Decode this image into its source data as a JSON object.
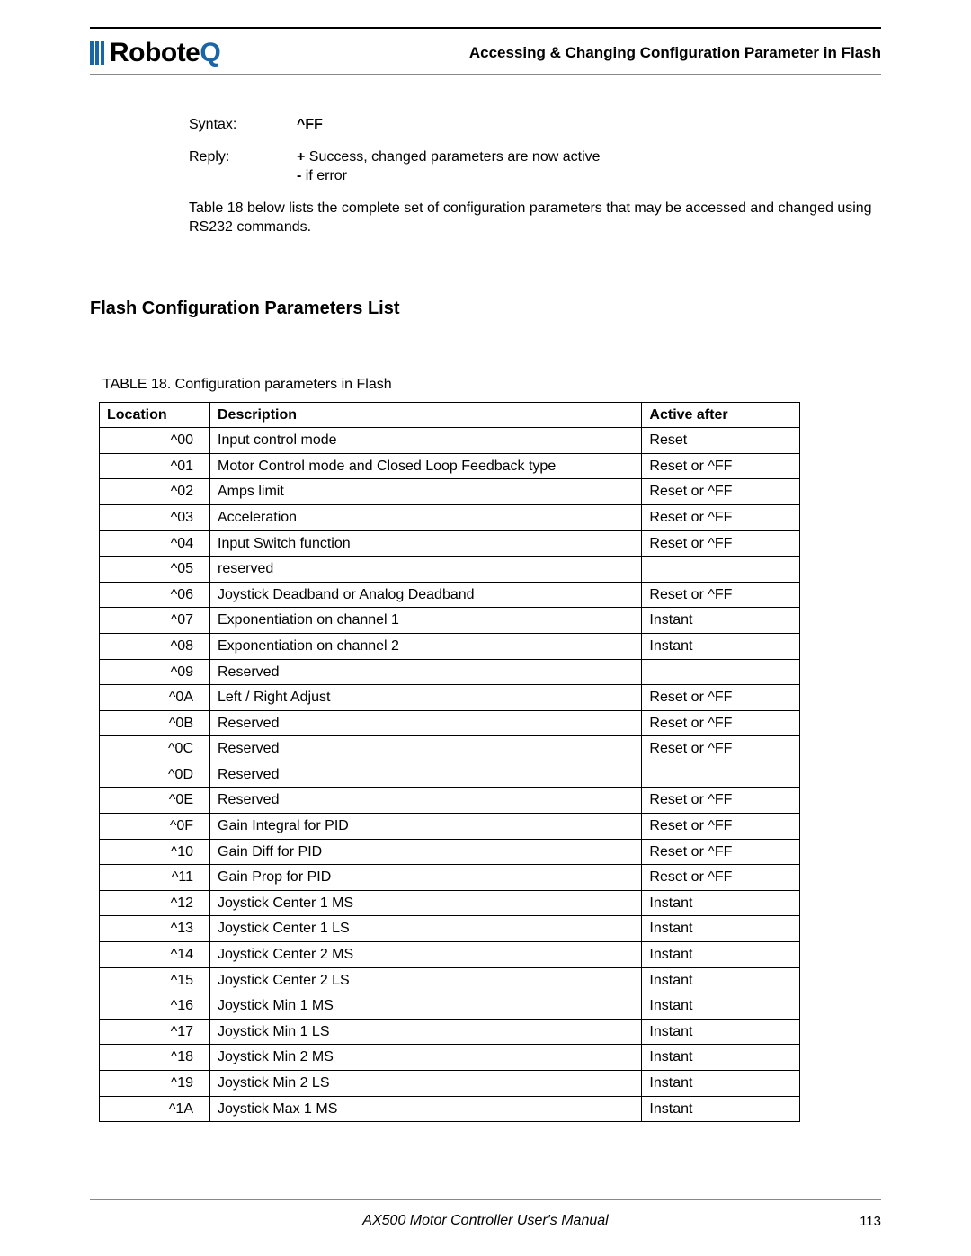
{
  "header": {
    "brand_text": "Robote",
    "brand_q": "Q",
    "title": "Accessing & Changing Configuration Parameter in Flash"
  },
  "syntax": {
    "label": "Syntax:",
    "value": "^FF"
  },
  "reply": {
    "label": "Reply:",
    "line1_prefix": "+",
    "line1_rest": " Success, changed parameters are now active",
    "line2_prefix": "-",
    "line2_rest": " if error"
  },
  "intro_para": "Table 18 below lists the complete set of configuration parameters that may be accessed and changed using RS232 commands.",
  "section_heading": "Flash Configuration Parameters List",
  "table_caption": "TABLE 18. Configuration parameters in Flash",
  "table_headers": {
    "location": "Location",
    "description": "Description",
    "active_after": "Active after"
  },
  "rows": [
    {
      "loc": "^00",
      "desc": "Input control mode",
      "act": "Reset"
    },
    {
      "loc": "^01",
      "desc": "Motor Control mode and Closed Loop Feedback type",
      "act": "Reset or ^FF"
    },
    {
      "loc": "^02",
      "desc": "Amps limit",
      "act": "Reset or ^FF"
    },
    {
      "loc": "^03",
      "desc": "Acceleration",
      "act": "Reset or ^FF"
    },
    {
      "loc": "^04",
      "desc": "Input Switch function",
      "act": "Reset or ^FF"
    },
    {
      "loc": "^05",
      "desc": "reserved",
      "act": ""
    },
    {
      "loc": "^06",
      "desc": "Joystick Deadband or Analog Deadband",
      "act": "Reset or ^FF"
    },
    {
      "loc": "^07",
      "desc": "Exponentiation on channel 1",
      "act": "Instant"
    },
    {
      "loc": "^08",
      "desc": "Exponentiation on channel 2",
      "act": "Instant"
    },
    {
      "loc": "^09",
      "desc": "Reserved",
      "act": ""
    },
    {
      "loc": "^0A",
      "desc": "Left / Right Adjust",
      "act": "Reset or ^FF"
    },
    {
      "loc": "^0B",
      "desc": "Reserved",
      "act": "Reset or ^FF"
    },
    {
      "loc": "^0C",
      "desc": "Reserved",
      "act": "Reset or ^FF"
    },
    {
      "loc": "^0D",
      "desc": "Reserved",
      "act": ""
    },
    {
      "loc": "^0E",
      "desc": "Reserved",
      "act": "Reset or ^FF"
    },
    {
      "loc": "^0F",
      "desc": "Gain Integral for PID",
      "act": "Reset or ^FF"
    },
    {
      "loc": "^10",
      "desc": "Gain Diff for PID",
      "act": "Reset or ^FF"
    },
    {
      "loc": "^11",
      "desc": "Gain Prop for PID",
      "act": "Reset or ^FF"
    },
    {
      "loc": "^12",
      "desc": "Joystick Center 1 MS",
      "act": "Instant"
    },
    {
      "loc": "^13",
      "desc": "Joystick Center 1 LS",
      "act": "Instant"
    },
    {
      "loc": "^14",
      "desc": "Joystick Center 2 MS",
      "act": "Instant"
    },
    {
      "loc": "^15",
      "desc": "Joystick Center 2 LS",
      "act": "Instant"
    },
    {
      "loc": "^16",
      "desc": "Joystick Min 1 MS",
      "act": "Instant"
    },
    {
      "loc": "^17",
      "desc": "Joystick Min 1 LS",
      "act": "Instant"
    },
    {
      "loc": "^18",
      "desc": "Joystick Min 2 MS",
      "act": "Instant"
    },
    {
      "loc": "^19",
      "desc": "Joystick Min 2 LS",
      "act": "Instant"
    },
    {
      "loc": "^1A",
      "desc": "Joystick Max 1 MS",
      "act": "Instant"
    }
  ],
  "footer": {
    "title": "AX500 Motor Controller User's Manual",
    "page": "113"
  }
}
